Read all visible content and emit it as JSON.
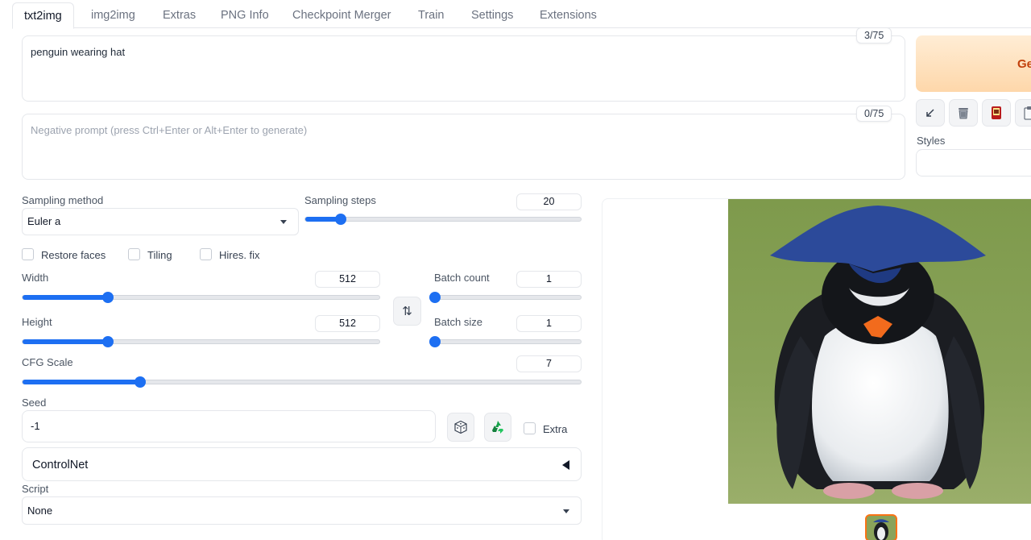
{
  "tabs": [
    "txt2img",
    "img2img",
    "Extras",
    "PNG Info",
    "Checkpoint Merger",
    "Train",
    "Settings",
    "Extensions"
  ],
  "prompt": {
    "value": "penguin wearing hat",
    "counter": "3/75"
  },
  "negative_prompt": {
    "placeholder": "Negative prompt (press Ctrl+Enter or Alt+Enter to generate)",
    "counter": "0/75"
  },
  "generate": {
    "label": "Ge"
  },
  "styles": {
    "label": "Styles"
  },
  "tool_buttons": [
    "paste-arrow-icon",
    "trash-icon",
    "model-card-icon",
    "clipboard-icon"
  ],
  "sampling_method": {
    "label": "Sampling method",
    "value": "Euler a"
  },
  "sampling_steps": {
    "label": "Sampling steps",
    "value": "20",
    "fraction": 0.13
  },
  "options": {
    "restore_faces": "Restore faces",
    "tiling": "Tiling",
    "hires_fix": "Hires. fix"
  },
  "width": {
    "label": "Width",
    "value": "512",
    "fraction": 0.24
  },
  "height": {
    "label": "Height",
    "value": "512",
    "fraction": 0.24
  },
  "swap_icon": "⇅",
  "batch_count": {
    "label": "Batch count",
    "value": "1",
    "fraction": 0
  },
  "batch_size": {
    "label": "Batch size",
    "value": "1",
    "fraction": 0
  },
  "cfg_scale": {
    "label": "CFG Scale",
    "value": "7",
    "fraction": 0.21
  },
  "seed": {
    "label": "Seed",
    "value": "-1",
    "extra_label": "Extra"
  },
  "controlnet": {
    "label": "ControlNet"
  },
  "script": {
    "label": "Script",
    "value": "None"
  },
  "colors": {
    "accent": "#1d6ff2",
    "generate_text": "#c2410c"
  }
}
